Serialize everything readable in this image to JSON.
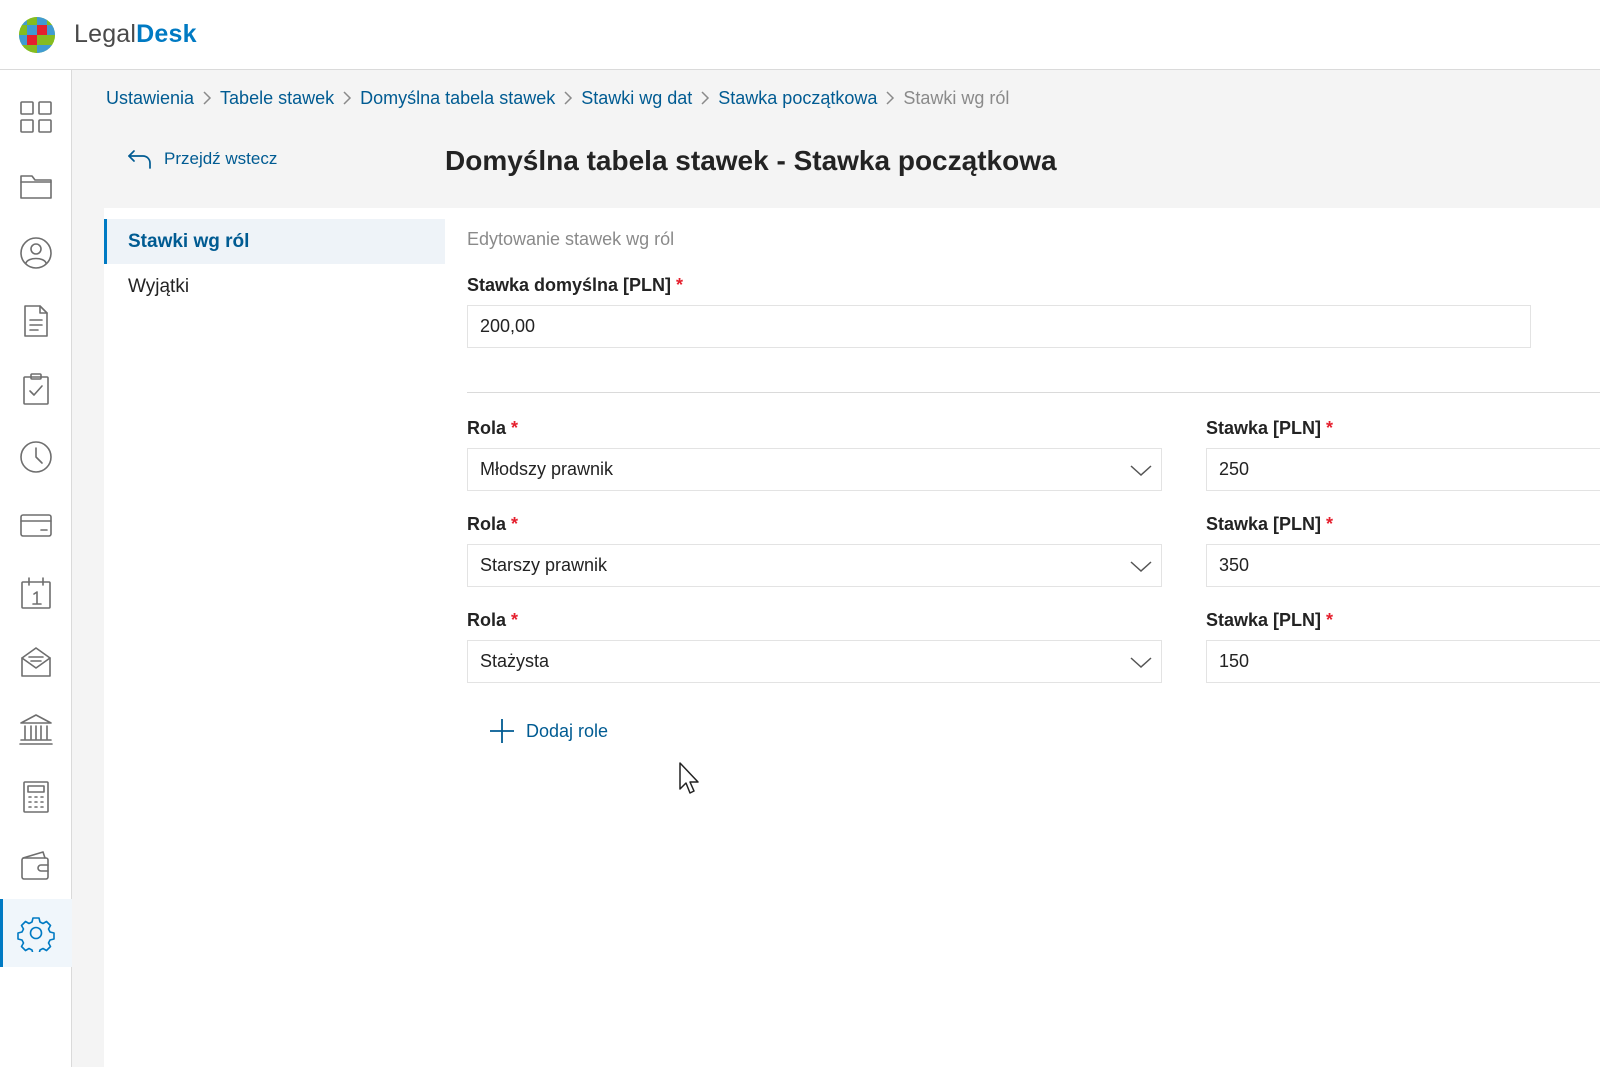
{
  "app": {
    "brand_part1": "Legal",
    "brand_part2": "Desk"
  },
  "sidebar": {
    "items": [
      {
        "icon": "dashboard-icon",
        "active": false
      },
      {
        "icon": "folder-icon",
        "active": false
      },
      {
        "icon": "user-icon",
        "active": false
      },
      {
        "icon": "document-icon",
        "active": false
      },
      {
        "icon": "clipboard-check-icon",
        "active": false
      },
      {
        "icon": "clock-icon",
        "active": false
      },
      {
        "icon": "card-icon",
        "active": false
      },
      {
        "icon": "calendar-icon",
        "active": false
      },
      {
        "icon": "inbox-icon",
        "active": false
      },
      {
        "icon": "bank-icon",
        "active": false
      },
      {
        "icon": "calculator-icon",
        "active": false
      },
      {
        "icon": "wallet-icon",
        "active": false
      },
      {
        "icon": "gear-icon",
        "active": true
      }
    ]
  },
  "breadcrumb": {
    "items": [
      "Ustawienia",
      "Tabele stawek",
      "Domyślna tabela stawek",
      "Stawki wg dat",
      "Stawka początkowa",
      "Stawki wg ról"
    ]
  },
  "back_label": "Przejdź wstecz",
  "page_title": "Domyślna tabela stawek - Stawka początkowa",
  "side_menu": {
    "items": [
      {
        "label": "Stawki wg ról",
        "selected": true
      },
      {
        "label": "Wyjątki",
        "selected": false
      }
    ]
  },
  "form": {
    "section_title": "Edytowanie stawek wg ról",
    "default_rate_label": "Stawka domyślna [PLN]",
    "default_rate_value": "200,00",
    "required_mark": "*",
    "role_label": "Rola",
    "rate_label": "Stawka [PLN]",
    "rows": [
      {
        "role": "Młodszy prawnik",
        "rate": "250"
      },
      {
        "role": "Starszy prawnik",
        "rate": "350"
      },
      {
        "role": "Stażysta",
        "rate": "150"
      }
    ],
    "add_role_label": "Dodaj role"
  },
  "colors": {
    "accent": "#007ac3",
    "link": "#005b92",
    "required": "#e5202e"
  }
}
